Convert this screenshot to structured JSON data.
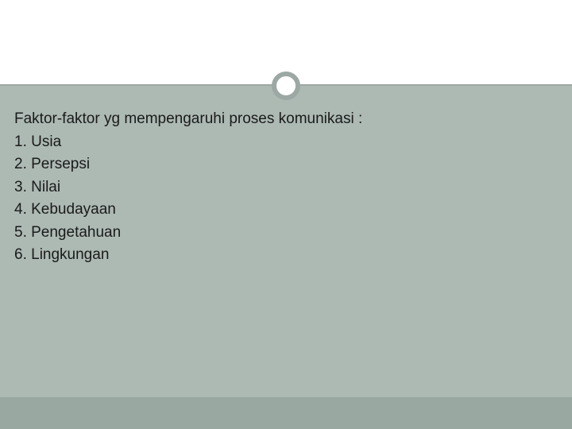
{
  "content": {
    "heading": "Faktor-faktor yg mempengaruhi proses komunikasi :",
    "items": {
      "0": "1. Usia",
      "1": "2. Persepsi",
      "2": "3. Nilai",
      "3": "4. Kebudayaan",
      "4": "5. Pengetahuan",
      "5": "6. Lingkungan"
    }
  }
}
